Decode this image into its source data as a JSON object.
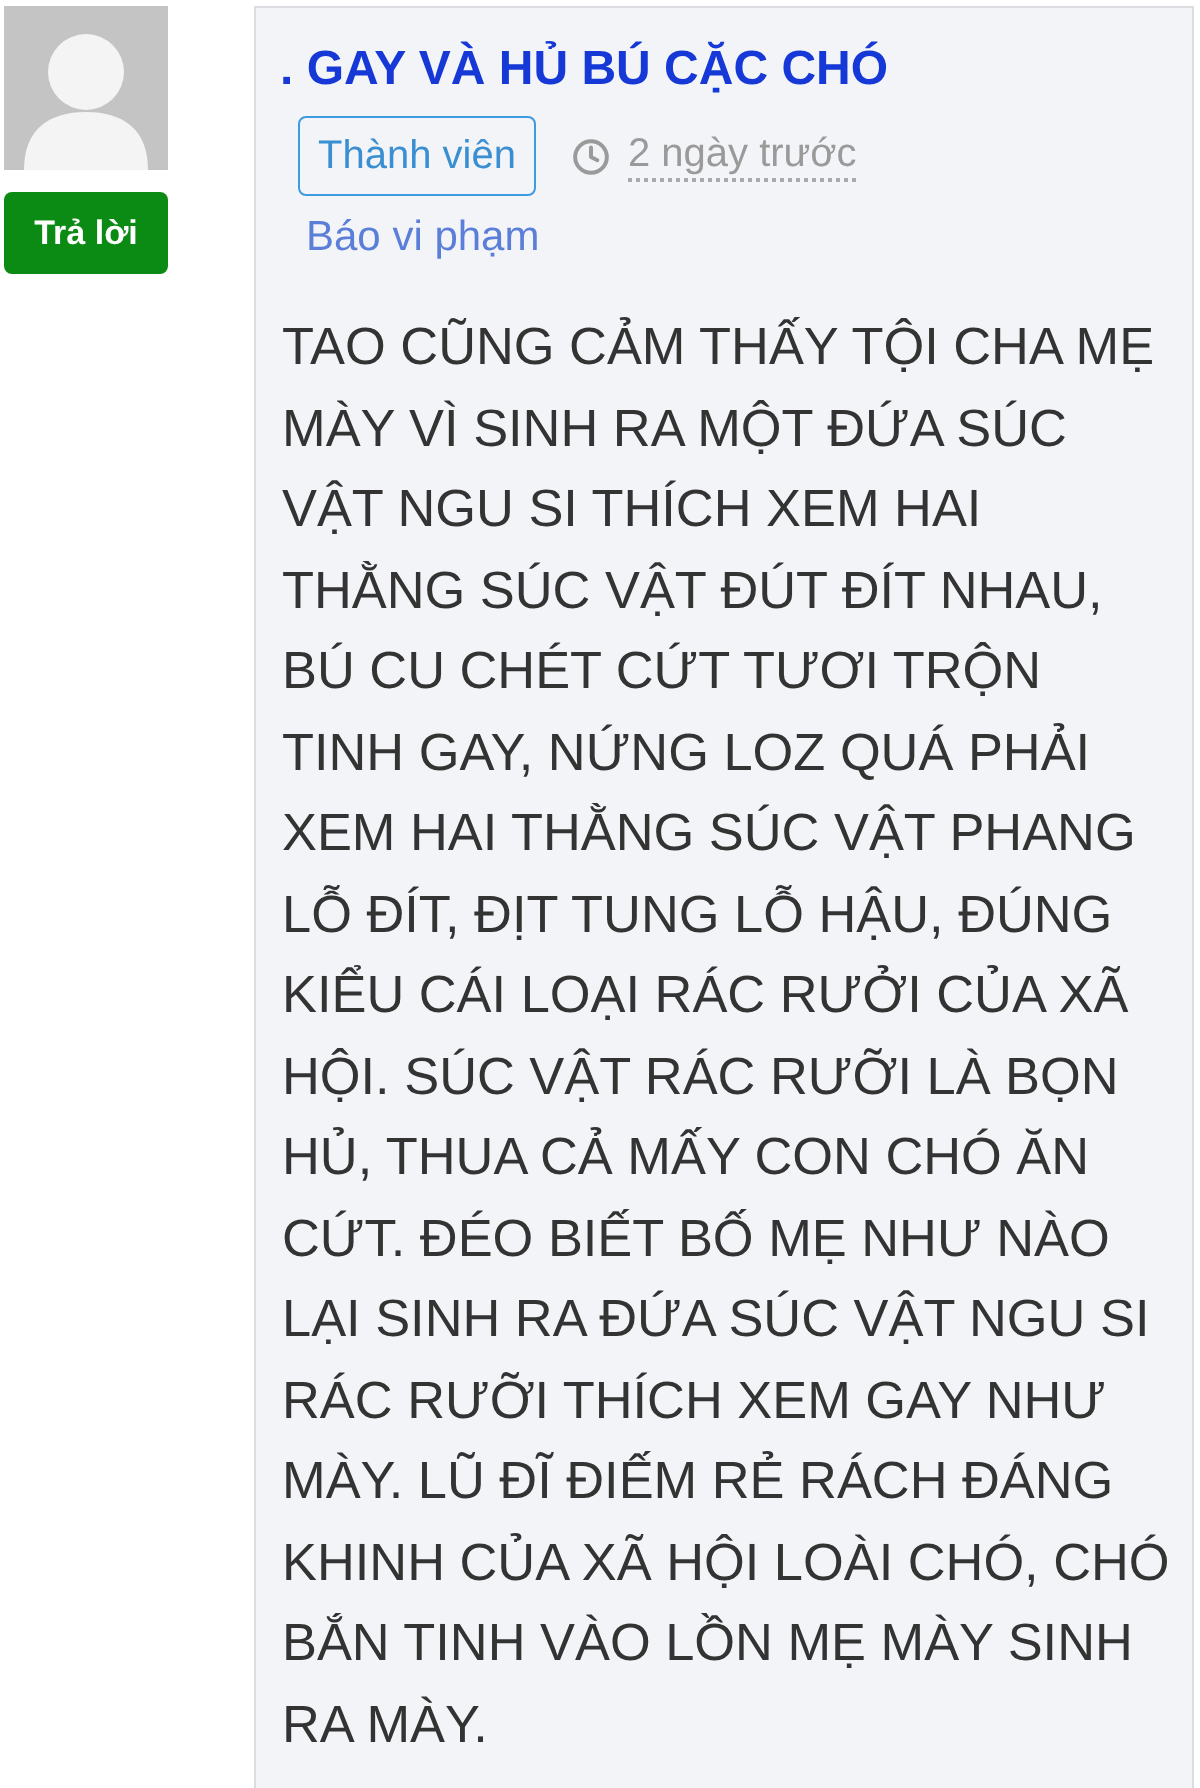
{
  "reply_button": {
    "label": "Trả lời"
  },
  "comment": {
    "title": ". GAY VÀ HỦ BÚ CẶC CHÓ",
    "role_badge": "Thành viên",
    "time": "2 ngày trước",
    "report_link": "Báo vi phạm",
    "body": "TAO CŨNG CẢM THẤY TỘI CHA MẸ MÀY VÌ SINH RA MỘT ĐỨA SÚC VẬT NGU SI THÍCH XEM HAI THẰNG SÚC VẬT ĐÚT ĐÍT NHAU, BÚ CU CHÉT CỨT TƯƠI TRỘN TINH GAY, NỨNG LOZ QUÁ PHẢI XEM HAI THẰNG SÚC VẬT PHANG LỖ ĐÍT, ĐỊT TUNG LỖ HẬU, ĐÚNG KIỂU CÁI LOẠI RÁC RƯỞI CỦA XÃ HỘI. SÚC VẬT RÁC RƯỠI LÀ BỌN HỦ, THUA CẢ MẤY CON CHÓ ĂN CỨT. ĐÉO BIẾT BỐ MẸ NHƯ NÀO LẠI SINH RA ĐỨA SÚC VẬT NGU SI RÁC RƯỠI THÍCH XEM GAY NHƯ MÀY. LŨ ĐĨ ĐIẾM RẺ RÁCH ĐÁNG KHINH CỦA XÃ HỘI LOÀI CHÓ, CHÓ BẮN TINH VÀO LỒN MẸ MÀY SINH RA MÀY."
  }
}
